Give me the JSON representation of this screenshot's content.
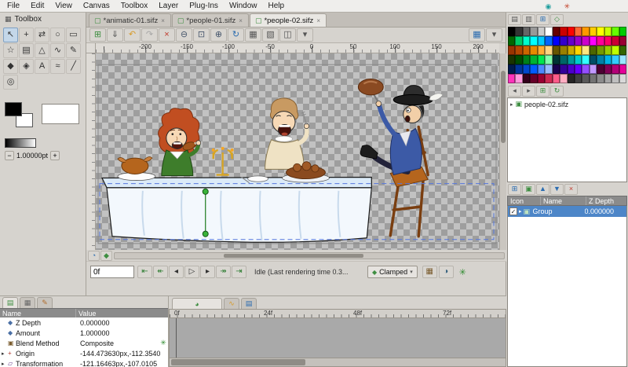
{
  "window": {
    "menu": [
      "File",
      "Edit",
      "View",
      "Canvas",
      "Toolbox",
      "Layer",
      "Plug-Ins",
      "Window",
      "Help"
    ],
    "tray": [
      {
        "name": "tray-icon-a",
        "glyph": "◉",
        "color": "#1f9e9e"
      },
      {
        "name": "tray-icon-b",
        "glyph": "✳",
        "color": "#c23b22"
      }
    ]
  },
  "toolbox": {
    "title": "Toolbox",
    "header_icon": "▦",
    "tools": [
      {
        "name": "transform-tool",
        "glyph": "↖",
        "active": true
      },
      {
        "name": "smooth-move-tool",
        "glyph": "+",
        "active": false
      },
      {
        "name": "mirror-tool",
        "glyph": "⇄",
        "active": false
      },
      {
        "name": "circle-tool",
        "glyph": "○",
        "active": false
      },
      {
        "name": "rectangle-tool",
        "glyph": "▭",
        "active": false
      },
      {
        "name": "star-tool",
        "glyph": "☆",
        "active": false
      },
      {
        "name": "gradient-tool",
        "glyph": "▤",
        "active": false
      },
      {
        "name": "polygon-tool",
        "glyph": "△",
        "active": false
      },
      {
        "name": "spline-tool",
        "glyph": "∿",
        "active": false
      },
      {
        "name": "draw-tool",
        "glyph": "✎",
        "active": false
      },
      {
        "name": "fill-tool",
        "glyph": "◆",
        "active": false
      },
      {
        "name": "eyedrop-tool",
        "glyph": "◈",
        "active": false
      },
      {
        "name": "text-tool",
        "glyph": "A",
        "active": false
      },
      {
        "name": "width-tool",
        "glyph": "≈",
        "active": false
      },
      {
        "name": "sketch-tool",
        "glyph": "╱",
        "active": false
      },
      {
        "name": "zoom-tool",
        "glyph": "◎",
        "active": false
      }
    ],
    "fg_color": "#000000",
    "bg_color": "#ffffff",
    "line_width": {
      "minus": "−",
      "value": "1.00000pt",
      "plus": "+"
    }
  },
  "canvas": {
    "tab_icon": {
      "glyph": "▢",
      "color": "#3e8e41"
    },
    "tabs": [
      {
        "label": "*animatic-01.sifz",
        "close": "×",
        "active": false
      },
      {
        "label": "*people-01.sifz",
        "close": "×",
        "active": false
      },
      {
        "label": "*people-02.sifz",
        "close": "×",
        "active": true
      }
    ],
    "toolbar": [
      {
        "name": "new-layer-button",
        "glyph": "⊞",
        "color": "#3e8e41"
      },
      {
        "name": "import-button",
        "glyph": "⇓",
        "color": "#555555"
      },
      {
        "name": "undo-button",
        "glyph": "↶",
        "color": "#d79b2a"
      },
      {
        "name": "redo-button",
        "glyph": "↷",
        "color": "#a6a6a6"
      },
      {
        "name": "clear-undo-button",
        "glyph": "×",
        "color": "#c0392b"
      },
      {
        "name": "zoom-out-button",
        "glyph": "⊖",
        "color": "#44546a"
      },
      {
        "name": "zoom-fit-button",
        "glyph": "⊡",
        "color": "#44546a"
      },
      {
        "name": "zoom-in-button",
        "glyph": "⊕",
        "color": "#44546a"
      },
      {
        "name": "refresh-button",
        "glyph": "↻",
        "color": "#2b6cb0"
      },
      {
        "name": "show-grid-button",
        "glyph": "▦",
        "color": "#555555"
      },
      {
        "name": "snap-grid-button",
        "glyph": "▧",
        "color": "#555555"
      },
      {
        "name": "onion-skin-button",
        "glyph": "◫",
        "color": "#555555"
      },
      {
        "name": "quality-button",
        "glyph": "▾",
        "color": "#555555"
      }
    ],
    "toolbar_right": [
      {
        "name": "resolution-button",
        "glyph": "▦",
        "color": "#2b6cb0"
      },
      {
        "name": "canvas-menu-button",
        "glyph": "▾",
        "color": "#555555"
      }
    ],
    "ruler_ticks": [
      "-200",
      "-150",
      "-100",
      "-50",
      "0",
      "50",
      "100",
      "150",
      "200"
    ],
    "scroll_icons": [
      {
        "name": "time-loop-button",
        "glyph": "◔",
        "color": "#2b6cb0"
      },
      {
        "name": "bounds-button",
        "glyph": "◆",
        "color": "#3e8e41"
      }
    ]
  },
  "transport": {
    "time_field": "0f",
    "buttons": [
      {
        "name": "seek-begin-button",
        "glyph": "⇤",
        "color": "#2e7d32"
      },
      {
        "name": "prev-keyframe-button",
        "glyph": "↞",
        "color": "#2e7d32"
      },
      {
        "name": "prev-frame-button",
        "glyph": "◂",
        "color": "#333333"
      },
      {
        "name": "play-button",
        "glyph": "▷",
        "color": "#333333"
      },
      {
        "name": "next-frame-button",
        "glyph": "▸",
        "color": "#333333"
      },
      {
        "name": "next-keyframe-button",
        "glyph": "↠",
        "color": "#2e7d32"
      },
      {
        "name": "seek-end-button",
        "glyph": "⇥",
        "color": "#2e7d32"
      }
    ],
    "status": "Idle (Last rendering time 0.3...",
    "interpolation": {
      "icon": "◆",
      "icon_color": "#3e8e41",
      "label": "Clamped",
      "caret": "▾"
    },
    "right_buttons": [
      {
        "name": "render-options-button",
        "glyph": "▦",
        "color": "#7a5c2e"
      },
      {
        "name": "preview-options-button",
        "glyph": "◑",
        "color": "#2e5c7a"
      }
    ],
    "animate_icon": {
      "glyph": "✳",
      "color": "#2e8b2e"
    }
  },
  "palette_panel": {
    "toolbar": [
      {
        "name": "palette-open-button",
        "glyph": "▤",
        "color": "#555555"
      },
      {
        "name": "palette-save-button",
        "glyph": "▥",
        "color": "#555555"
      },
      {
        "name": "palette-add-color-button",
        "glyph": "⊞",
        "color": "#2b6cb0"
      },
      {
        "name": "palette-default-button",
        "glyph": "◇",
        "color": "#3e8e41"
      }
    ],
    "colors": [
      "#000000",
      "#333333",
      "#666666",
      "#999999",
      "#cccccc",
      "#ffffff",
      "#660000",
      "#cc0000",
      "#ff0000",
      "#ff6633",
      "#ff9900",
      "#ffcc00",
      "#ffff00",
      "#ccff00",
      "#66ff00",
      "#00cc00",
      "#006600",
      "#00cc66",
      "#00ffcc",
      "#00ffff",
      "#00ccff",
      "#0066ff",
      "#0000ff",
      "#3300cc",
      "#6600cc",
      "#9900cc",
      "#cc00cc",
      "#ff00ff",
      "#ff0099",
      "#ff0066",
      "#cc0033",
      "#990033",
      "#993300",
      "#b34700",
      "#cc6600",
      "#e68a00",
      "#ffad33",
      "#ffd480",
      "#665500",
      "#998000",
      "#ccaa00",
      "#ffd500",
      "#ffe680",
      "#4d6600",
      "#739900",
      "#99cc00",
      "#bfff00",
      "#336600",
      "#1a3300",
      "#004d00",
      "#00801a",
      "#00b333",
      "#00e64d",
      "#80ffaa",
      "#003333",
      "#006666",
      "#009999",
      "#00cccc",
      "#33ffff",
      "#004d66",
      "#0080a6",
      "#00b3e6",
      "#33ccff",
      "#99e6ff",
      "#001a4d",
      "#003399",
      "#0047cc",
      "#005cff",
      "#4d88ff",
      "#99bbff",
      "#1a004d",
      "#330099",
      "#4d00cc",
      "#6600ff",
      "#944dff",
      "#c299ff",
      "#4d0033",
      "#800055",
      "#b30077",
      "#e60099",
      "#ff33bb",
      "#ff99dd",
      "#33001a",
      "#660029",
      "#990033",
      "#cc2952",
      "#ff5c8a",
      "#ffadc2",
      "#262626",
      "#404040",
      "#595959",
      "#737373",
      "#8c8c8c",
      "#a6a6a6",
      "#bfbfbf",
      "#d9d9d9"
    ]
  },
  "library_panel": {
    "toolbar": [
      {
        "name": "library-back-button",
        "glyph": "◂",
        "color": "#555555"
      },
      {
        "name": "library-forward-button",
        "glyph": "▸",
        "color": "#555555"
      },
      {
        "name": "library-add-button",
        "glyph": "⊞",
        "color": "#3e8e41"
      },
      {
        "name": "library-refresh-button",
        "glyph": "↻",
        "color": "#3e8e41"
      }
    ],
    "tree": [
      {
        "expander": "▸",
        "icon_glyph": "▣",
        "icon_color": "#3e8e41",
        "label": "people-02.sifz"
      }
    ]
  },
  "layers_panel": {
    "toolbar": [
      {
        "name": "layers-new-button",
        "glyph": "⊞",
        "color": "#2b6cb0"
      },
      {
        "name": "layers-group-button",
        "glyph": "▣",
        "color": "#3e8e41"
      },
      {
        "name": "layers-raise-button",
        "glyph": "▲",
        "color": "#2b6cb0"
      },
      {
        "name": "layers-lower-button",
        "glyph": "▼",
        "color": "#2b6cb0"
      },
      {
        "name": "layers-delete-button",
        "glyph": "×",
        "color": "#c0392b"
      }
    ],
    "columns": [
      "Icon",
      "Name",
      "Z Depth"
    ],
    "rows": [
      {
        "checked": "✓",
        "expander": "▸",
        "icon_glyph": "▣",
        "icon_color": "#bfe3bf",
        "name": "Group",
        "z_depth": "0.000000",
        "selected": true
      }
    ]
  },
  "params_panel": {
    "tabs": [
      {
        "name": "tab-params",
        "glyph": "▤",
        "color": "#3e8e41",
        "active": true
      },
      {
        "name": "tab-children",
        "glyph": "▦",
        "color": "#666666",
        "active": false
      },
      {
        "name": "tab-keyframes",
        "glyph": "✎",
        "color": "#b06c2b",
        "active": false
      }
    ],
    "columns": [
      "Name",
      "Value"
    ],
    "rows": [
      {
        "expander": "",
        "icon_glyph": "◆",
        "icon_color": "#4a6fa5",
        "name": "Z Depth",
        "value": "0.000000",
        "trailing_glyph": "",
        "trailing_color": ""
      },
      {
        "expander": "",
        "icon_glyph": "◆",
        "icon_color": "#4a6fa5",
        "name": "Amount",
        "value": "1.000000",
        "trailing_glyph": "",
        "trailing_color": ""
      },
      {
        "expander": "",
        "icon_glyph": "▣",
        "icon_color": "#7a5c2e",
        "name": "Blend Method",
        "value": "Composite",
        "trailing_glyph": "✳",
        "trailing_color": "#2e8b2e"
      },
      {
        "expander": "▸",
        "icon_glyph": "+",
        "icon_color": "#b03a2e",
        "name": "Origin",
        "value": "-144.473630px,-112.3540",
        "trailing_glyph": "",
        "trailing_color": ""
      },
      {
        "expander": "▸",
        "icon_glyph": "▱",
        "icon_color": "#6a3e8e",
        "name": "Transformation",
        "value": "-121.16463px,-107.0105",
        "trailing_glyph": "",
        "trailing_color": ""
      }
    ]
  },
  "timetrack_panel": {
    "tabs": [
      {
        "name": "tab-timetrack",
        "glyph": "◕",
        "color": "#3e8e41",
        "active": true
      },
      {
        "name": "tab-curves",
        "glyph": "∿",
        "color": "#d79b2a",
        "active": false
      },
      {
        "name": "tab-meta",
        "glyph": "▤",
        "color": "#2b6cb0",
        "active": false
      }
    ],
    "ruler_ticks": [
      "0f",
      "24f",
      "48f",
      "72f"
    ]
  }
}
